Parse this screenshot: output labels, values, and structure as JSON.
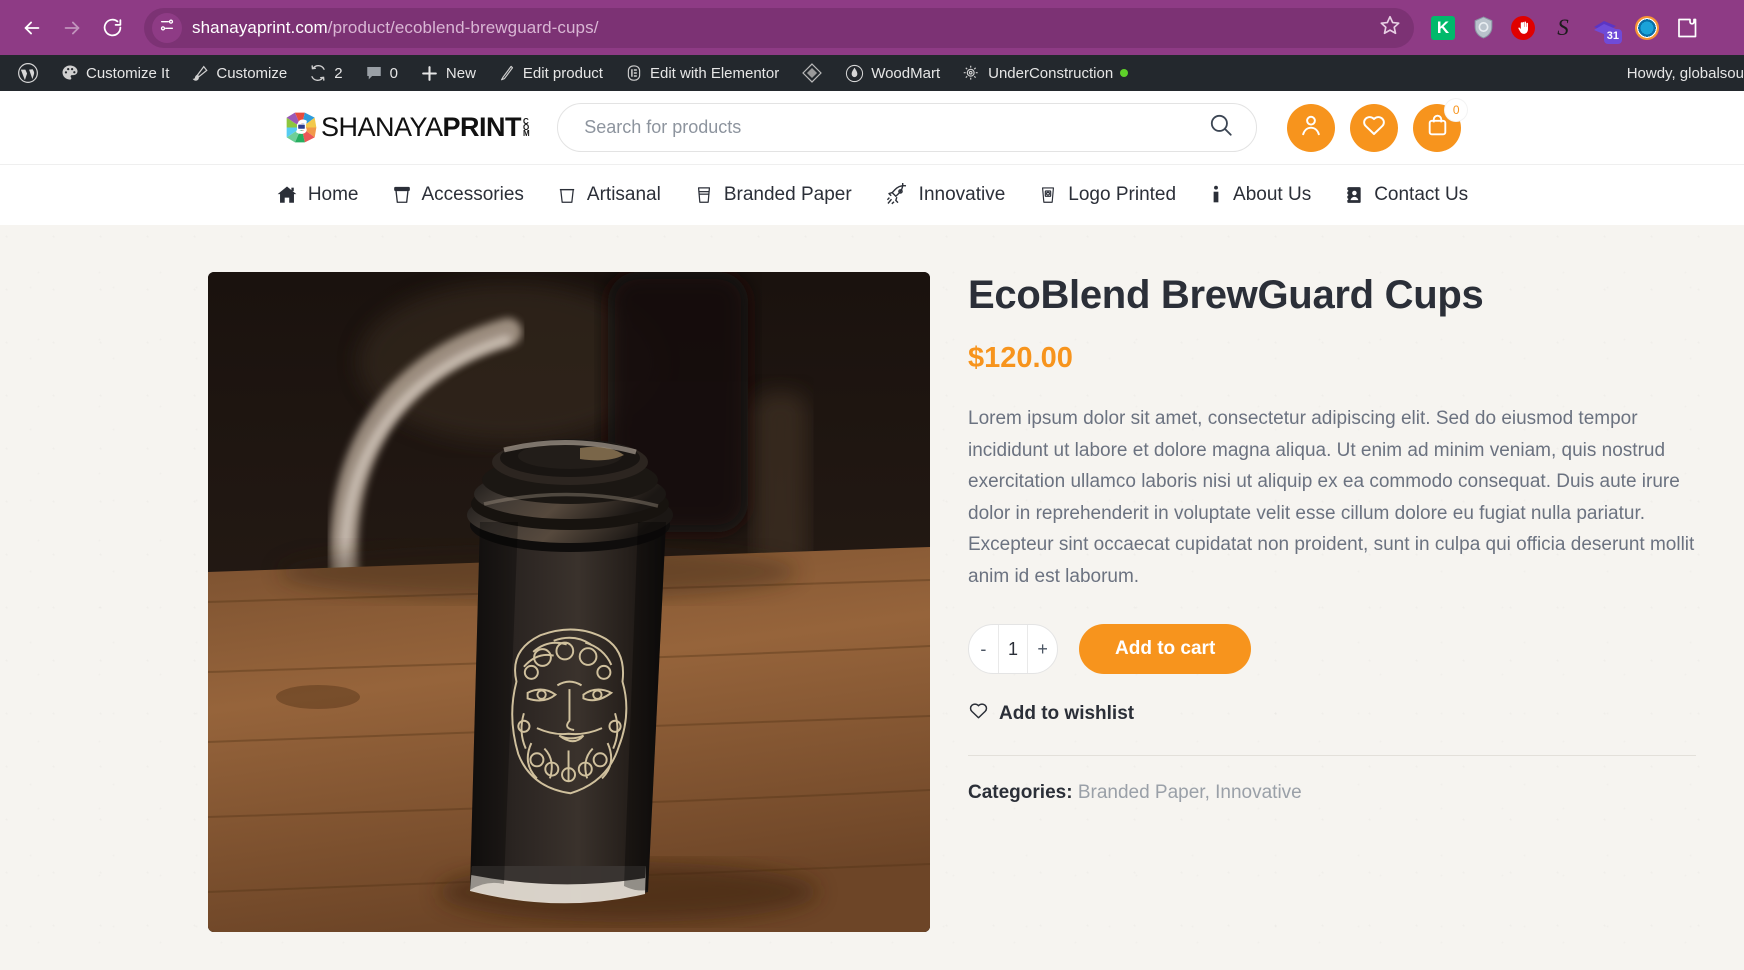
{
  "browser": {
    "back_icon": "back-arrow-icon",
    "forward_icon": "forward-arrow-icon",
    "reload_icon": "reload-icon",
    "site_info_icon": "site-settings-icon",
    "url_domain": "shanayaprint.com",
    "url_path": "/product/ecoblend-brewguard-cups/",
    "bookmark_icon": "star-icon",
    "extensions": [
      {
        "name": "kaspersky-extension-icon",
        "label": "K"
      },
      {
        "name": "shield-extension-icon",
        "label": ""
      },
      {
        "name": "adblock-extension-icon",
        "label": ""
      },
      {
        "name": "grammarly-extension-icon",
        "label": "S"
      },
      {
        "name": "calendar-extension-icon",
        "label": "31"
      },
      {
        "name": "colorful-ring-extension-icon",
        "label": ""
      },
      {
        "name": "extensions-puzzle-icon",
        "label": ""
      }
    ]
  },
  "adminbar": {
    "wp_logo_icon": "wordpress-logo-icon",
    "items": [
      {
        "label": "Customize It",
        "icon": "palette-icon"
      },
      {
        "label": "Customize",
        "icon": "brush-icon"
      },
      {
        "label": "2",
        "icon": "updates-icon"
      },
      {
        "label": "0",
        "icon": "comments-icon"
      },
      {
        "label": "New",
        "icon": "plus-icon"
      },
      {
        "label": "Edit product",
        "icon": "pencil-icon"
      },
      {
        "label": "Edit with Elementor",
        "icon": "elementor-icon"
      },
      {
        "label": "",
        "icon": "diamond-icon"
      },
      {
        "label": "WoodMart",
        "icon": "woodmart-icon"
      },
      {
        "label": "UnderConstruction",
        "icon": "gear-icon",
        "status_dot": "#5fd12a"
      }
    ],
    "howdy": "Howdy, globalsou"
  },
  "header": {
    "logo_primary": "SHANAYA",
    "logo_secondary": "PRINT",
    "logo_tld_line1": "C",
    "logo_tld_line2": "O",
    "logo_tld_line3": "M",
    "search_placeholder": "Search for products",
    "search_value": "",
    "search_icon": "search-icon",
    "account_icon": "user-icon",
    "wishlist_icon": "heart-icon",
    "cart_icon": "shopping-bag-icon",
    "cart_count": "0",
    "accent_color": "#f7941d"
  },
  "nav": {
    "items": [
      {
        "label": "Home",
        "icon": "home-icon"
      },
      {
        "label": "Accessories",
        "icon": "cup-icon"
      },
      {
        "label": "Artisanal",
        "icon": "cup-outline-icon"
      },
      {
        "label": "Branded Paper",
        "icon": "paper-cup-icon"
      },
      {
        "label": "Innovative",
        "icon": "rocket-icon"
      },
      {
        "label": "Logo Printed",
        "icon": "logo-cup-icon"
      },
      {
        "label": "About Us",
        "icon": "info-icon"
      },
      {
        "label": "Contact Us",
        "icon": "contact-card-icon"
      }
    ]
  },
  "product": {
    "image_alt": "black-coffee-cup-photo",
    "title": "EcoBlend BrewGuard Cups",
    "price": "$120.00",
    "description": "Lorem ipsum dolor sit amet, consectetur adipiscing elit. Sed do eiusmod tempor incididunt ut labore et dolore magna aliqua. Ut enim ad minim veniam, quis nostrud exercitation ullamco laboris nisi ut aliquip ex ea commodo consequat. Duis aute irure dolor in reprehenderit in voluptate velit esse cillum dolore eu fugiat nulla pariatur. Excepteur sint occaecat cupidatat non proident, sunt in culpa qui officia deserunt mollit anim id est laborum.",
    "qty_minus": "-",
    "qty_value": "1",
    "qty_plus": "+",
    "add_to_cart_label": "Add to cart",
    "wishlist_label": "Add to wishlist",
    "categories_label": "Categories:",
    "category_1": "Branded Paper",
    "category_separator": ",",
    "category_2": "Innovative"
  }
}
